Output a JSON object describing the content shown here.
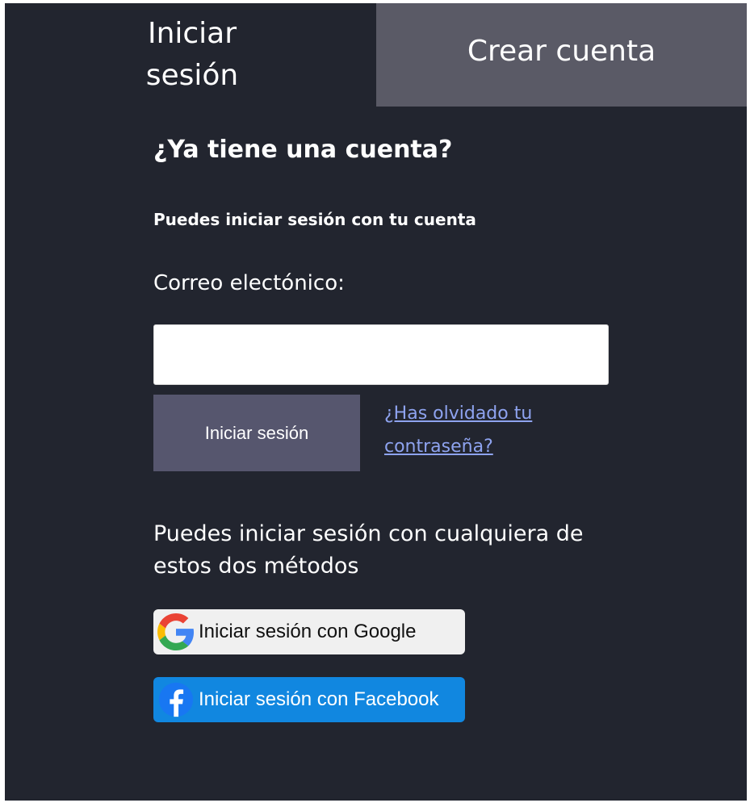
{
  "tabs": {
    "login_label": "Iniciar sesión",
    "register_label": "Crear cuenta"
  },
  "login": {
    "heading": "¿Ya tiene una cuenta?",
    "subheading": "Puedes iniciar sesión con tu cuenta",
    "email_label": "Correo electónico:",
    "email_value": "",
    "email_placeholder": "",
    "submit_label": "Iniciar sesión",
    "forgot_link": "¿Has olvidado tu contraseña?"
  },
  "social": {
    "intro": "Puedes iniciar sesión con cualquiera de estos dos métodos",
    "google_label": "Iniciar sesión con Google",
    "google_icon": "google-g-icon",
    "facebook_label": "Iniciar sesión con Facebook",
    "facebook_icon": "facebook-f-icon"
  },
  "colors": {
    "background": "#22252f",
    "inactive_tab": "#5a5a66",
    "submit_button": "#56566e",
    "link": "#8ea3ef",
    "google_button": "#f0f0f0",
    "facebook_button": "#1187e0"
  }
}
